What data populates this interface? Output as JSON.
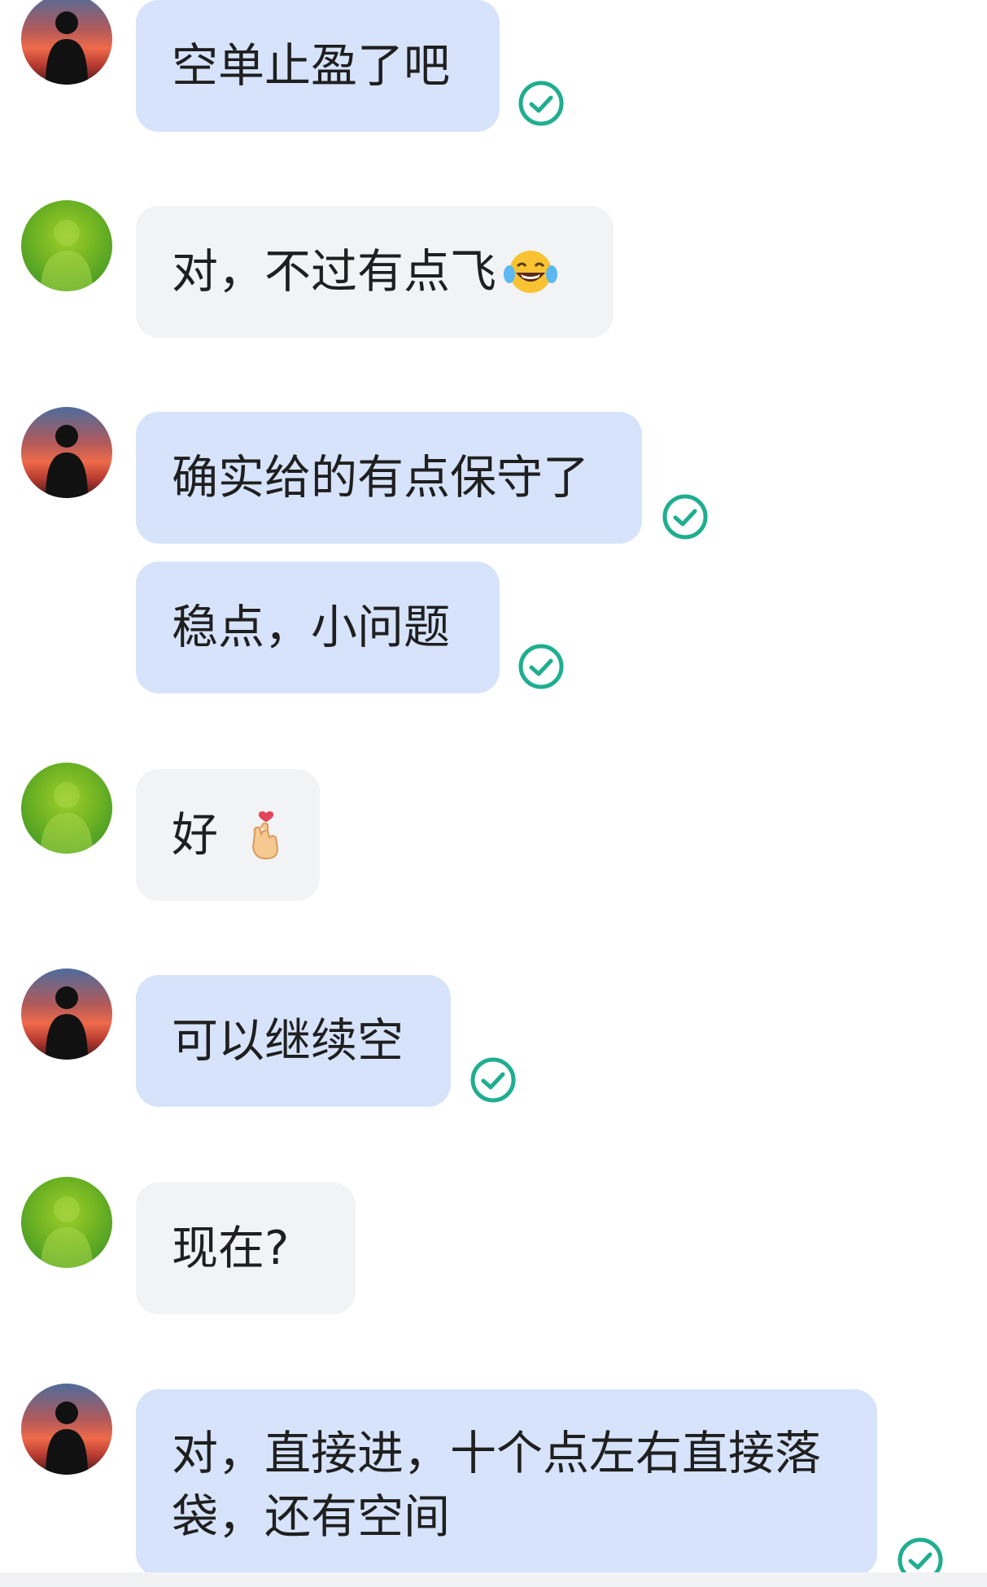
{
  "messages": [
    {
      "sender": "self",
      "text": "空单止盈了吧",
      "status_icon": "read-check-icon"
    },
    {
      "sender": "other",
      "text": "对，不过有点飞",
      "emoji": "laughing-tears-emoji"
    },
    {
      "sender": "self",
      "text": "确实给的有点保守了",
      "status_icon": "read-check-icon"
    },
    {
      "sender": "self",
      "text": "稳点，小问题",
      "status_icon": "read-check-icon"
    },
    {
      "sender": "other",
      "text": "好",
      "emoji": "finger-heart-emoji"
    },
    {
      "sender": "self",
      "text": "可以继续空",
      "status_icon": "read-check-icon"
    },
    {
      "sender": "other",
      "text": "现在?"
    },
    {
      "sender": "self",
      "text": "对，直接进，十个点左右直接落袋，还有空间",
      "status_icon": "read-check-icon"
    }
  ],
  "colors": {
    "self_bubble": "#d6e3fb",
    "other_bubble": "#f2f3f5",
    "check": "#1fae8f",
    "text": "#1f1f1f"
  }
}
